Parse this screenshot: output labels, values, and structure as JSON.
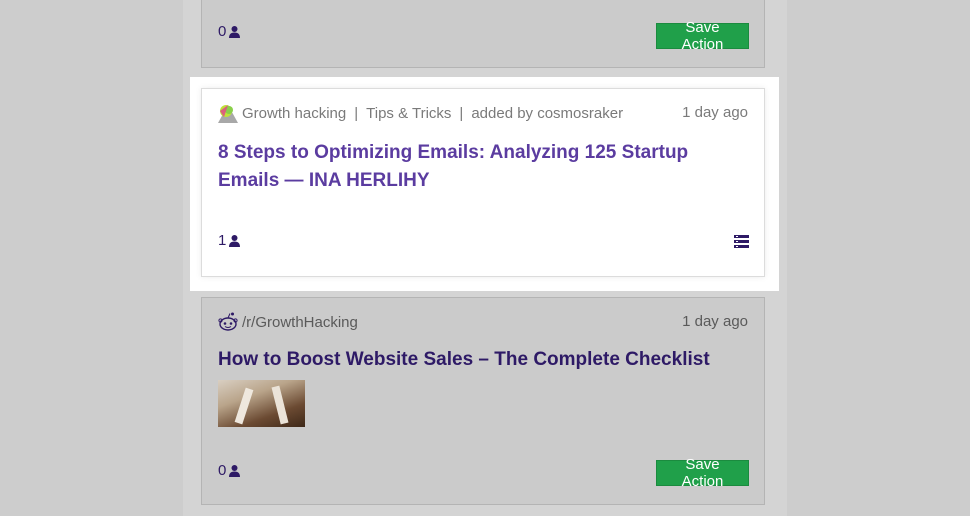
{
  "cards": [
    {
      "count": "0",
      "save_label": "Save Action"
    },
    {
      "source": "Growth hacking",
      "category": "Tips & Tricks",
      "added_by": "added by cosmosraker",
      "time": "1 day ago",
      "title": "8 Steps to Optimizing Emails: Analyzing 125 Startup Emails — INA HERLIHY",
      "count": "1",
      "source_icon": "growth-hacking-logo-icon",
      "action_icon": "list-menu-icon"
    },
    {
      "source": "/r/GrowthHacking",
      "time": "1 day ago",
      "title": "How to Boost Website Sales – The Complete Checklist",
      "count": "0",
      "save_label": "Save Action",
      "source_icon": "reddit-icon"
    }
  ],
  "colors": {
    "accent_purple": "#5b3ca0",
    "dark_purple": "#2e1a66",
    "save_green": "#20a04a"
  }
}
